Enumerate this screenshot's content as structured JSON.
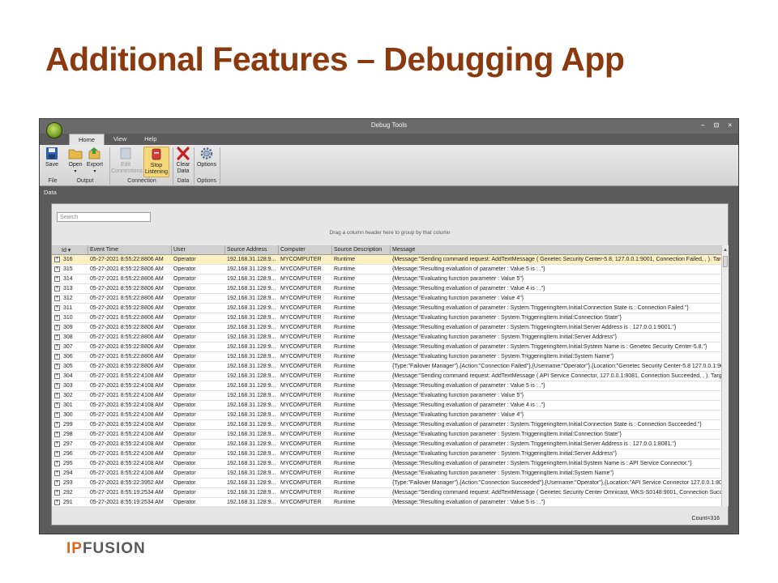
{
  "slide": {
    "title": "Additional Features – Debugging App"
  },
  "brand": {
    "ip": "IP",
    "fusion": "FUSION"
  },
  "window": {
    "title": "Debug Tools",
    "controls": [
      "–",
      "⊡",
      "×"
    ],
    "tabs": [
      "Home",
      "View",
      "Help"
    ]
  },
  "ribbon": {
    "save": "Save",
    "open": "Open",
    "export": "Export",
    "edit_connections": [
      "Edit",
      "Connections"
    ],
    "stop_listening": [
      "Stop",
      "Listening"
    ],
    "clear_data": [
      "Clear",
      "Data"
    ],
    "options": "Options",
    "groups": {
      "file": "File",
      "output": "Output",
      "connection": "Connection",
      "data": "Data",
      "options": "Options"
    }
  },
  "data_panel": {
    "header": "Data",
    "search_placeholder": "Search",
    "group_hint": "Drag a column header here to group by that column",
    "count": "Count=316"
  },
  "grid": {
    "columns": [
      "Id",
      "Event Time",
      "User",
      "Source Address",
      "Computer",
      "Source Description",
      "Message"
    ],
    "rows": [
      [
        "316",
        "05-27-2021 8:55:22:8806 AM",
        "Operator",
        "192.168.31.128:9...",
        "MYCOMPUTER",
        "Runtime",
        "{Message:\"Sending command request: AddTextMessage ( Genetec Security Center-5.8, 127.0.0.1:9001, Connection Failed, , ). Targ..."
      ],
      [
        "315",
        "05-27-2021 8:55:22:8806 AM",
        "Operator",
        "192.168.31.128:9...",
        "MYCOMPUTER",
        "Runtime",
        "{Message:\"Resulting evaluation of parameter : Value 5 is : .\"}"
      ],
      [
        "314",
        "05-27-2021 8:55:22:8806 AM",
        "Operator",
        "192.168.31.128:9...",
        "MYCOMPUTER",
        "Runtime",
        "{Message:\"Evaluating function parameter : Value 5\"}"
      ],
      [
        "313",
        "05-27-2021 8:55:22:8806 AM",
        "Operator",
        "192.168.31.128:9...",
        "MYCOMPUTER",
        "Runtime",
        "{Message:\"Resulting evaluation of parameter : Value 4 is : .\"}"
      ],
      [
        "312",
        "05-27-2021 8:55:22:8806 AM",
        "Operator",
        "192.168.31.128:9...",
        "MYCOMPUTER",
        "Runtime",
        "{Message:\"Evaluating function parameter : Value 4\"}"
      ],
      [
        "311",
        "05-27-2021 8:55:22:8806 AM",
        "Operator",
        "192.168.31.128:9...",
        "MYCOMPUTER",
        "Runtime",
        "{Message:\"Resulting evaluation of parameter : System.TriggeringItem.Initial:Connection State is : Connection Failed.\"}"
      ],
      [
        "310",
        "05-27-2021 8:55:22:8806 AM",
        "Operator",
        "192.168.31.128:9...",
        "MYCOMPUTER",
        "Runtime",
        "{Message:\"Evaluating function parameter : System.TriggeringItem.Initial:Connection State\"}"
      ],
      [
        "309",
        "05-27-2021 8:55:22:8806 AM",
        "Operator",
        "192.168.31.128:9...",
        "MYCOMPUTER",
        "Runtime",
        "{Message:\"Resulting evaluation of parameter : System.TriggeringItem.Initial:Server Address is : 127.0.0.1:9001.\"}"
      ],
      [
        "308",
        "05-27-2021 8:55:22:8806 AM",
        "Operator",
        "192.168.31.128:9...",
        "MYCOMPUTER",
        "Runtime",
        "{Message:\"Evaluating function parameter : System.TriggeringItem.Initial:Server Address\"}"
      ],
      [
        "307",
        "05-27-2021 8:55:22:8806 AM",
        "Operator",
        "192.168.31.128:9...",
        "MYCOMPUTER",
        "Runtime",
        "{Message:\"Resulting evaluation of parameter : System.TriggeringItem.Initial:System Name is : Genetec Security Center-5.8.\"}"
      ],
      [
        "306",
        "05-27-2021 8:55:22:8806 AM",
        "Operator",
        "192.168.31.128:9...",
        "MYCOMPUTER",
        "Runtime",
        "{Message:\"Evaluating function parameter : System.TriggeringItem.Initial:System Name\"}"
      ],
      [
        "305",
        "05-27-2021 8:55:22:8806 AM",
        "Operator",
        "192.168.31.128:9...",
        "MYCOMPUTER",
        "Runtime",
        "{Type:\"Failover Manager\"},{Action:\"Connection Failed\"},{Username:\"Operator\"},{Location:\"Genetec Security Center-5.8 127.0.0.1:90..."
      ],
      [
        "304",
        "05-27-2021 8:55:22:4108 AM",
        "Operator",
        "192.168.31.128:9...",
        "MYCOMPUTER",
        "Runtime",
        "{Message:\"Sending command request: AddTextMessage ( API Service Connector, 127.0.0.1:8081, Connection Succeeded, , ). Targ..."
      ],
      [
        "303",
        "05-27-2021 8:55:22:4108 AM",
        "Operator",
        "192.168.31.128:9...",
        "MYCOMPUTER",
        "Runtime",
        "{Message:\"Resulting evaluation of parameter : Value 5 is : .\"}"
      ],
      [
        "302",
        "05-27-2021 8:55:22:4108 AM",
        "Operator",
        "192.168.31.128:9...",
        "MYCOMPUTER",
        "Runtime",
        "{Message:\"Evaluating function parameter : Value 5\"}"
      ],
      [
        "301",
        "05-27-2021 8:55:22:4108 AM",
        "Operator",
        "192.168.31.128:9...",
        "MYCOMPUTER",
        "Runtime",
        "{Message:\"Resulting evaluation of parameter : Value 4 is : .\"}"
      ],
      [
        "300",
        "05-27-2021 8:55:22:4108 AM",
        "Operator",
        "192.168.31.128:9...",
        "MYCOMPUTER",
        "Runtime",
        "{Message:\"Evaluating function parameter : Value 4\"}"
      ],
      [
        "299",
        "05-27-2021 8:55:22:4108 AM",
        "Operator",
        "192.168.31.128:9...",
        "MYCOMPUTER",
        "Runtime",
        "{Message:\"Resulting evaluation of parameter : System.TriggeringItem.Initial:Connection State is : Connection Succeeded.\"}"
      ],
      [
        "298",
        "05-27-2021 8:55:22:4108 AM",
        "Operator",
        "192.168.31.128:9...",
        "MYCOMPUTER",
        "Runtime",
        "{Message:\"Evaluating function parameter : System.TriggeringItem.Initial:Connection State\"}"
      ],
      [
        "297",
        "05-27-2021 8:55:22:4108 AM",
        "Operator",
        "192.168.31.128:9...",
        "MYCOMPUTER",
        "Runtime",
        "{Message:\"Resulting evaluation of parameter : System.TriggeringItem.Initial:Server Address is : 127.0.0.1:8081.\"}"
      ],
      [
        "296",
        "05-27-2021 8:55:22:4108 AM",
        "Operator",
        "192.168.31.128:9...",
        "MYCOMPUTER",
        "Runtime",
        "{Message:\"Evaluating function parameter : System.TriggeringItem.Initial:Server Address\"}"
      ],
      [
        "295",
        "05-27-2021 8:55:22:4108 AM",
        "Operator",
        "192.168.31.128:9...",
        "MYCOMPUTER",
        "Runtime",
        "{Message:\"Resulting evaluation of parameter : System.TriggeringItem.Initial:System Name is : API Service Connector.\"}"
      ],
      [
        "294",
        "05-27-2021 8:55:22:4108 AM",
        "Operator",
        "192.168.31.128:9...",
        "MYCOMPUTER",
        "Runtime",
        "{Message:\"Evaluating function parameter : System.TriggeringItem.Initial:System Name\"}"
      ],
      [
        "293",
        "05-27-2021 8:55:22:3952 AM",
        "Operator",
        "192.168.31.128:9...",
        "MYCOMPUTER",
        "Runtime",
        "{Type:\"Failover Manager\"},{Action:\"Connection Succeeded\"},{Username:\"Operator\"},{Location:\"API Service Connector 127.0.0.1:808..."
      ],
      [
        "292",
        "05-27-2021 8:55:19:2534 AM",
        "Operator",
        "192.168.31.128:9...",
        "MYCOMPUTER",
        "Runtime",
        "{Message:\"Sending command request: AddTextMessage ( Genetec Security Center Omnicast, WKS-S0148:9001, Connection Succe..."
      ],
      [
        "291",
        "05-27-2021 8:55:19:2534 AM",
        "Operator",
        "192.168.31.128:9...",
        "MYCOMPUTER",
        "Runtime",
        "{Message:\"Resulting evaluation of parameter : Value 5 is : .\"}"
      ]
    ]
  },
  "colors": {
    "title": "#8b3a0f",
    "selected_row": "#fdf1c3",
    "brand_ip": "#d9661f",
    "brand_fusion": "#5a5a5a"
  }
}
